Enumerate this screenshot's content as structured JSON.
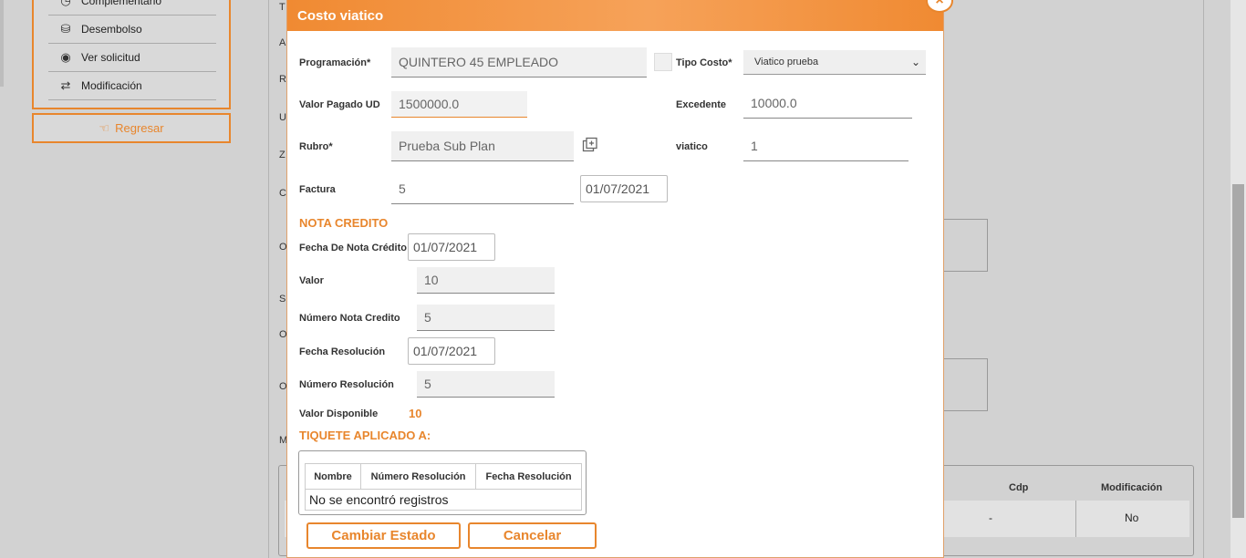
{
  "sidebar": {
    "items": [
      {
        "label": "Complementario",
        "icon": "clock-icon"
      },
      {
        "label": "Desembolso",
        "icon": "coins-icon"
      },
      {
        "label": "Ver solicitud",
        "icon": "eye-icon"
      },
      {
        "label": "Modificación",
        "icon": "swap-arrows-icon"
      }
    ],
    "back_label": "Regresar"
  },
  "background": {
    "letters": [
      "T",
      "A",
      "R",
      "U",
      "Z",
      "C",
      "O",
      "S",
      "O",
      "O",
      "M"
    ],
    "table": {
      "headers": [
        "Cdp",
        "Modificación"
      ],
      "row": [
        "-",
        "No"
      ]
    }
  },
  "modal": {
    "title": "Costo viatico",
    "close": "×",
    "fields": {
      "programacion_label": "Programación*",
      "programacion_value": "QUINTERO 45 EMPLEADO",
      "tipo_costo_label": "Tipo Costo*",
      "tipo_costo_value": "Viatico prueba",
      "valor_pagado_label": "Valor Pagado UD",
      "valor_pagado_value": "1500000.0",
      "excedente_label": "Excedente",
      "excedente_value": "10000.0",
      "rubro_label": "Rubro*",
      "rubro_value": "Prueba Sub Plan",
      "viatico_label": "viatico",
      "viatico_value": "1",
      "factura_label": "Factura",
      "factura_value": "5",
      "factura_fecha": "01/07/2021"
    },
    "nota_credito": {
      "title": "NOTA CREDITO",
      "fecha_label": "Fecha De Nota Crédito",
      "fecha_value": "01/07/2021",
      "valor_label": "Valor",
      "valor_value": "10",
      "numero_label": "Número Nota Credito",
      "numero_value": "5",
      "fecha_res_label": "Fecha Resolución",
      "fecha_res_value": "01/07/2021",
      "numero_res_label": "Número Resolución",
      "numero_res_value": "5",
      "disponible_label": "Valor Disponible",
      "disponible_value": "10"
    },
    "tiquete": {
      "title": "TIQUETE APLICADO A:",
      "headers": [
        "Nombre",
        "Número Resolución",
        "Fecha Resolución"
      ],
      "empty": "No se encontró registros"
    },
    "buttons": {
      "cambiar": "Cambiar Estado",
      "cancelar": "Cancelar"
    }
  },
  "colors": {
    "accent": "#e8862d",
    "header": "#f08a32"
  }
}
